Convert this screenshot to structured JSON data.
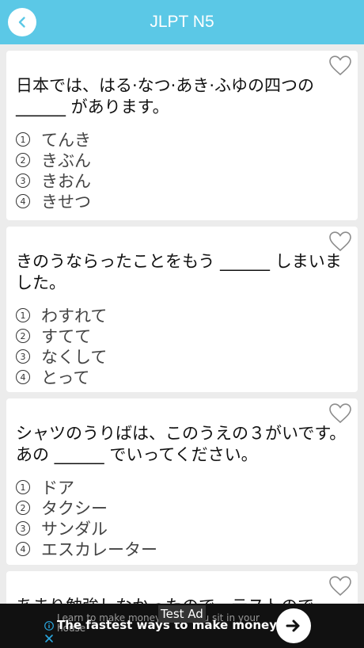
{
  "header": {
    "title": "JLPT N5"
  },
  "questions": [
    {
      "text": "日本では、はる·なつ·あき·ふゆの四つの ______ があります。",
      "options": [
        "てんき",
        "きぶん",
        "きおん",
        "きせつ"
      ]
    },
    {
      "text": "きのうならったことをもう ______ しまいました。",
      "options": [
        "わすれて",
        "すてて",
        "なくして",
        "とって"
      ]
    },
    {
      "text": "シャツのうりばは、このうえの３がいです。あの ______ でいってください。",
      "options": [
        "ドア",
        "タクシー",
        "サンダル",
        "エスカレーター"
      ]
    },
    {
      "text": "あまり勉強しなかったので、テストので",
      "options": []
    }
  ],
  "option_numbers": [
    "1",
    "2",
    "3",
    "4"
  ],
  "ad": {
    "label": "Test Ad",
    "subtext": "Learn to make money while you sit in your house",
    "headline": "The fastest ways to make money"
  },
  "colors": {
    "header": "#5bc8e6",
    "background": "#ececec",
    "ad_background": "#111111"
  },
  "icons": {
    "back": "chevron-left-icon",
    "favorite": "heart-outline-icon",
    "ad_go": "arrow-right-icon",
    "ad_info": "info-icon",
    "ad_close": "close-icon"
  }
}
